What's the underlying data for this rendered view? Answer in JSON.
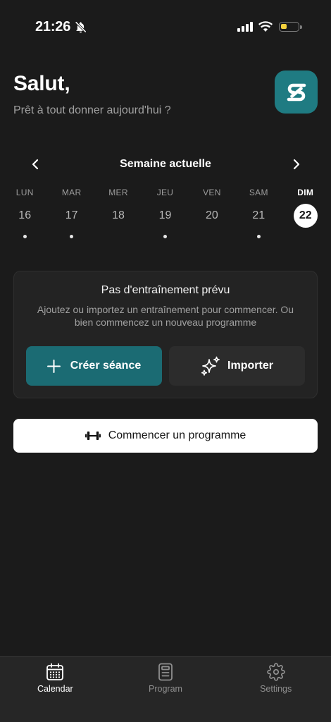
{
  "status_bar": {
    "time": "21:26",
    "icons": [
      "bell-slash-icon",
      "signal-icon",
      "wifi-icon",
      "battery-icon"
    ],
    "battery_level_percent": 35
  },
  "header": {
    "greeting": "Salut,",
    "subtitle": "Prêt à tout donner aujourd'hui ?",
    "logo_icon": "app-logo-icon"
  },
  "week": {
    "title": "Semaine actuelle",
    "prev_icon": "chevron-left-icon",
    "next_icon": "chevron-right-icon",
    "days": [
      {
        "label": "LUN",
        "date": "16",
        "has_workout": true,
        "selected": false
      },
      {
        "label": "MAR",
        "date": "17",
        "has_workout": true,
        "selected": false
      },
      {
        "label": "MER",
        "date": "18",
        "has_workout": false,
        "selected": false
      },
      {
        "label": "JEU",
        "date": "19",
        "has_workout": true,
        "selected": false
      },
      {
        "label": "VEN",
        "date": "20",
        "has_workout": false,
        "selected": false
      },
      {
        "label": "SAM",
        "date": "21",
        "has_workout": true,
        "selected": false
      },
      {
        "label": "DIM",
        "date": "22",
        "has_workout": false,
        "selected": true
      }
    ]
  },
  "empty_state": {
    "title": "Pas d'entraînement prévu",
    "description": "Ajoutez ou importez un entraînement pour commencer. Ou bien commencez un nouveau programme",
    "create_button": {
      "label": "Créer séance",
      "icon": "plus-icon"
    },
    "import_button": {
      "label": "Importer",
      "icon": "sparkles-icon"
    }
  },
  "start_program_button": {
    "label": "Commencer un programme",
    "icon": "dumbbell-icon"
  },
  "tab_bar": {
    "items": [
      {
        "label": "Calendar",
        "icon": "calendar-icon",
        "active": true
      },
      {
        "label": "Program",
        "icon": "document-icon",
        "active": false
      },
      {
        "label": "Settings",
        "icon": "gear-icon",
        "active": false
      }
    ]
  },
  "colors": {
    "background": "#1b1b1b",
    "card": "#232323",
    "accent_teal": "#1b6b73",
    "logo_teal": "#1f7b82",
    "battery_fill": "#f4d13d",
    "text_muted": "#a0a0a0"
  }
}
